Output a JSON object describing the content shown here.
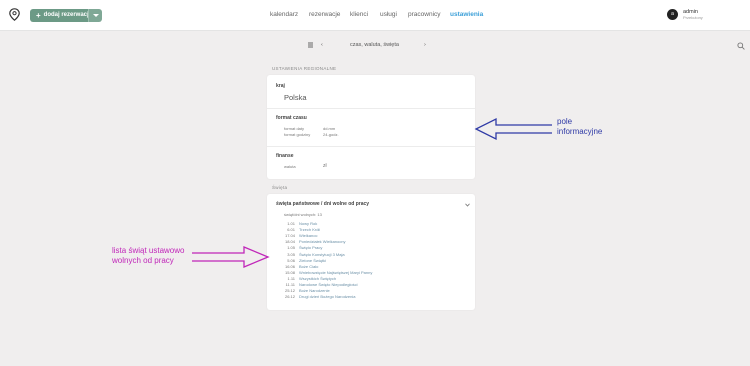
{
  "header": {
    "add_button": "dodaj rezerwację",
    "nav": [
      {
        "label": "kalendarz",
        "active": false
      },
      {
        "label": "rezerwacje",
        "active": false
      },
      {
        "label": "klienci",
        "active": false
      },
      {
        "label": "usługi",
        "active": false
      },
      {
        "label": "pracownicy",
        "active": false
      },
      {
        "label": "ustawienia",
        "active": true
      }
    ],
    "user": {
      "initial": "a",
      "name": "admin",
      "role": "Przełożony"
    }
  },
  "subbar": {
    "title": "czas, waluta, święta"
  },
  "regional": {
    "section_title": "USTAWIENIA REGIONALNE",
    "country_label": "kraj",
    "country_value": "Polska",
    "time_format_label": "format czasu",
    "time_rows": [
      {
        "label": "format daty",
        "value": "dd.mm"
      },
      {
        "label": "format godziny",
        "value": "24-godz."
      }
    ],
    "finance_label": "finanse",
    "finance_rows": [
      {
        "label": "waluta",
        "value": "zł"
      }
    ]
  },
  "holidays": {
    "section_title": "Święta",
    "card_title": "święta państwowe / dni wolne od pracy",
    "count_text": "świąt/dni wolnych: 13",
    "items": [
      {
        "date": "1.01",
        "name": "Nowy Rok"
      },
      {
        "date": "6.01",
        "name": "Trzech Króli"
      },
      {
        "date": "17.04",
        "name": "Wielkanoc"
      },
      {
        "date": "18.04",
        "name": "Poniedziałek Wielkanocny"
      },
      {
        "date": "1.05",
        "name": "Święto Pracy"
      },
      {
        "date": "3.05",
        "name": "Święto Konstytucji 3 Maja"
      },
      {
        "date": "5.06",
        "name": "Zielone Świątki"
      },
      {
        "date": "16.06",
        "name": "Boże Ciało"
      },
      {
        "date": "15.08",
        "name": "Wniebowzięcie Najświętszej Maryi Panny"
      },
      {
        "date": "1.11",
        "name": "Wszystkich Świętych"
      },
      {
        "date": "11.11",
        "name": "Narodowe Święto Niepodległości"
      },
      {
        "date": "25.12",
        "name": "Boże Narodzenie"
      },
      {
        "date": "26.12",
        "name": "Drugi dzień Bożego Narodzenia"
      }
    ]
  },
  "annotations": {
    "info_field": [
      "pole",
      "informacyjne"
    ],
    "holiday_list": [
      "lista świąt ustawowo",
      "wolnych od pracy"
    ]
  },
  "colors": {
    "accent_green": "#6c9a86",
    "active_nav": "#3b9fd8",
    "annot_blue": "#2f3aa6",
    "annot_pink": "#c026b9"
  }
}
